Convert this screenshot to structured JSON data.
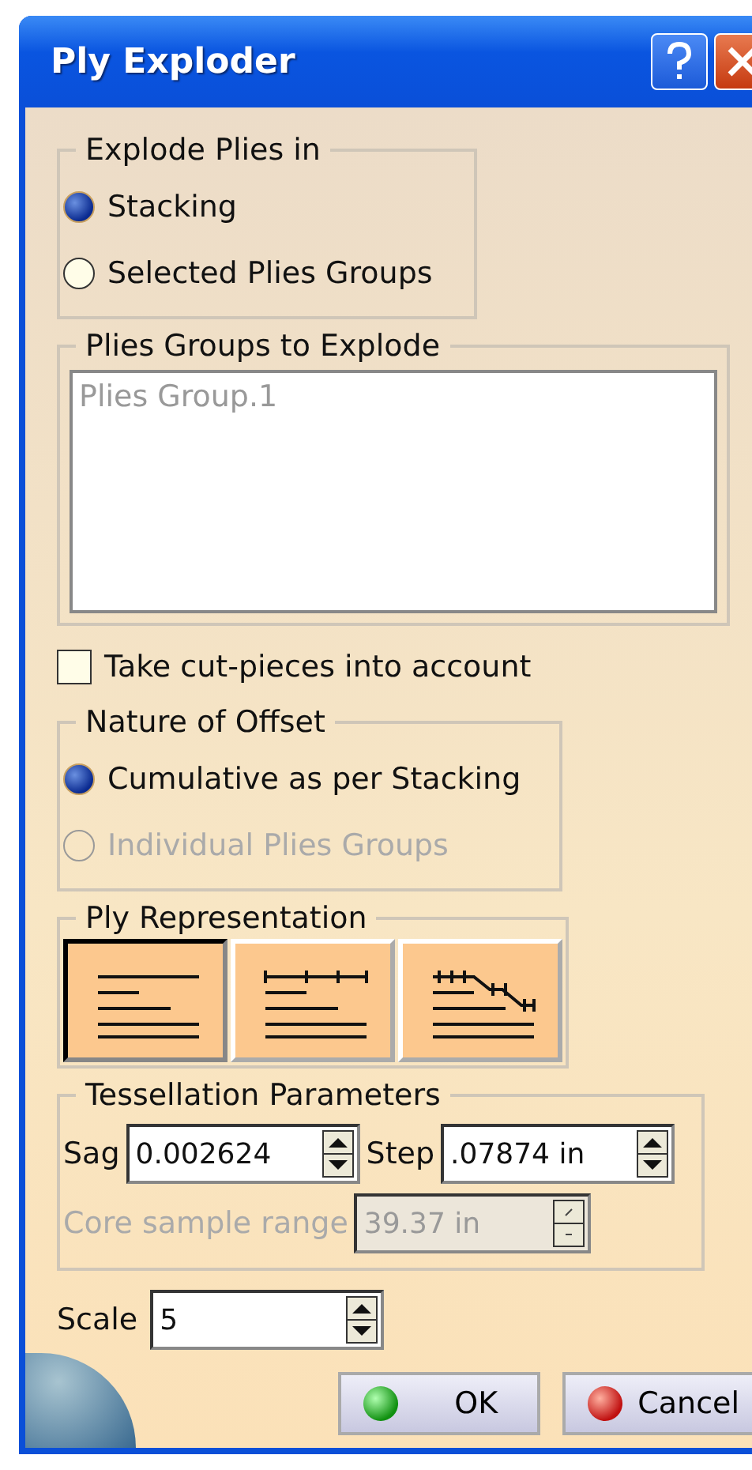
{
  "window": {
    "title": "Ply Exploder"
  },
  "explode_plies_in": {
    "title": "Explode Plies in",
    "options": [
      {
        "label": "Stacking",
        "selected": true,
        "disabled": false
      },
      {
        "label": "Selected Plies Groups",
        "selected": false,
        "disabled": false
      }
    ]
  },
  "plies_groups_to_explode": {
    "title": "Plies Groups to Explode",
    "disabled": true,
    "items": [
      "Plies Group.1"
    ]
  },
  "cut_pieces": {
    "label": "Take cut-pieces into account",
    "checked": false
  },
  "nature_of_offset": {
    "title": "Nature of Offset",
    "options": [
      {
        "label": "Cumulative as per Stacking",
        "selected": true,
        "disabled": false
      },
      {
        "label": "Individual Plies Groups",
        "selected": false,
        "disabled": true
      }
    ]
  },
  "ply_representation": {
    "title": "Ply Representation",
    "options": [
      {
        "kind": "plain",
        "selected": true
      },
      {
        "kind": "ticked",
        "selected": false
      },
      {
        "kind": "stepped",
        "selected": false
      }
    ]
  },
  "tessellation_parameters": {
    "title": "Tessellation Parameters",
    "sag": {
      "label": "Sag",
      "value": "0.002624",
      "disabled": false
    },
    "step": {
      "label": "Step",
      "value": ".07874 in",
      "disabled": false
    },
    "core_sample_range": {
      "label": "Core sample range",
      "value": "39.37 in",
      "disabled": true
    }
  },
  "scale": {
    "label": "Scale",
    "value": "5",
    "disabled": false
  },
  "buttons": [
    {
      "label": "OK",
      "kind": "ok"
    },
    {
      "label": "Cancel",
      "kind": "cancel"
    }
  ]
}
